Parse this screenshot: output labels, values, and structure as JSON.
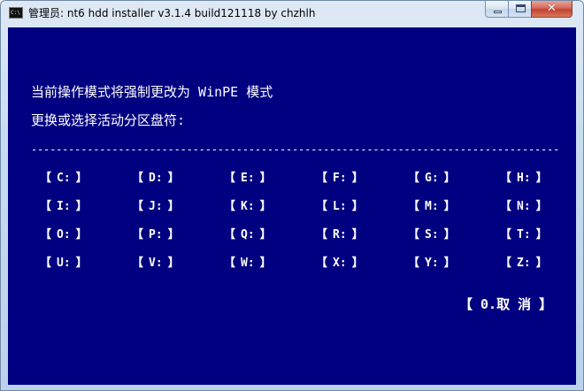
{
  "window": {
    "title": "管理员:  nt6 hdd installer v3.1.4 build121118 by chzhlh",
    "icon_text": "C:\\",
    "controls": {
      "minimize_icon": "minimize-icon",
      "maximize_icon": "maximize-icon",
      "close_label": "✕"
    }
  },
  "console": {
    "background": "#000080",
    "text_color": "#ffffff",
    "mode_line": "当前操作模式将强制更改为 WinPE 模式",
    "prompt_line": "更换或选择活动分区盘符:",
    "divider": "-----------------------------------------------------------------------------------------------",
    "bracket_open": "【",
    "bracket_close": "】",
    "drives": [
      [
        "C:",
        "D:",
        "E:",
        "F:",
        "G:",
        "H:"
      ],
      [
        "I:",
        "J:",
        "K:",
        "L:",
        "M:",
        "N:"
      ],
      [
        "O:",
        "P:",
        "Q:",
        "R:",
        "S:",
        "T:"
      ],
      [
        "U:",
        "V:",
        "W:",
        "X:",
        "Y:",
        "Z:"
      ]
    ],
    "cancel_label": "【 0.取 消 】"
  }
}
